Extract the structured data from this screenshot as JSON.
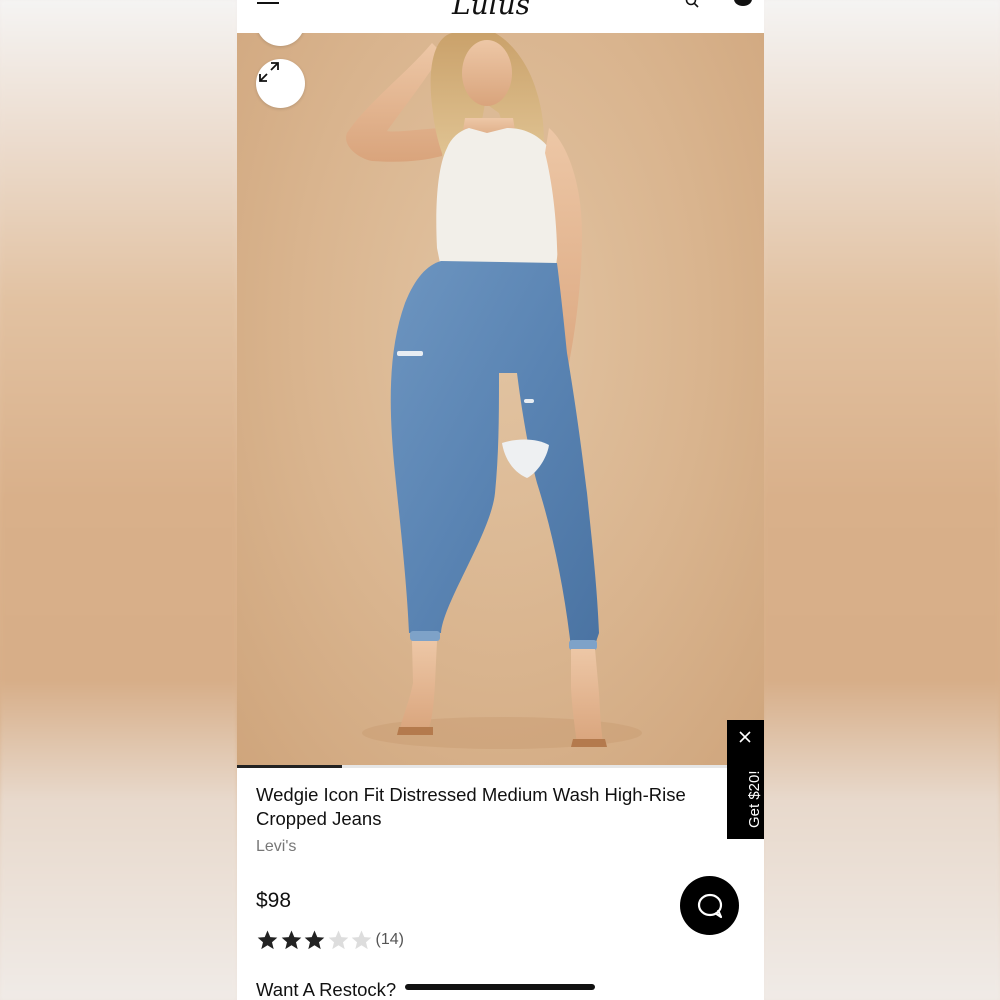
{
  "header": {
    "logo_text": "Lulus",
    "icons": [
      "hamburger-menu-icon",
      "search-icon",
      "cart-icon"
    ]
  },
  "gallery": {
    "image_alt": "Model wearing Wedgie Icon Fit Distressed Medium Wash High-Rise Cropped Jeans with white tank top",
    "progress": 0.2,
    "icons": [
      "share-icon",
      "expand-icon"
    ]
  },
  "product": {
    "title": "Wedgie Icon Fit Distressed Medium Wash High-Rise Cropped Jeans",
    "brand": "Levi's",
    "price": "$98",
    "rating_value": 3,
    "rating_max": 5,
    "review_count": "(14)",
    "restock_label": "Want A Restock?"
  },
  "promo": {
    "label": "Get $20!",
    "close_icon": "close-icon"
  },
  "chat": {
    "icon": "chat-bubble-icon"
  },
  "colors": {
    "accent": "#000000",
    "star_filled": "#222222",
    "star_empty": "#dddddd",
    "backdrop": "#d9b48e"
  }
}
